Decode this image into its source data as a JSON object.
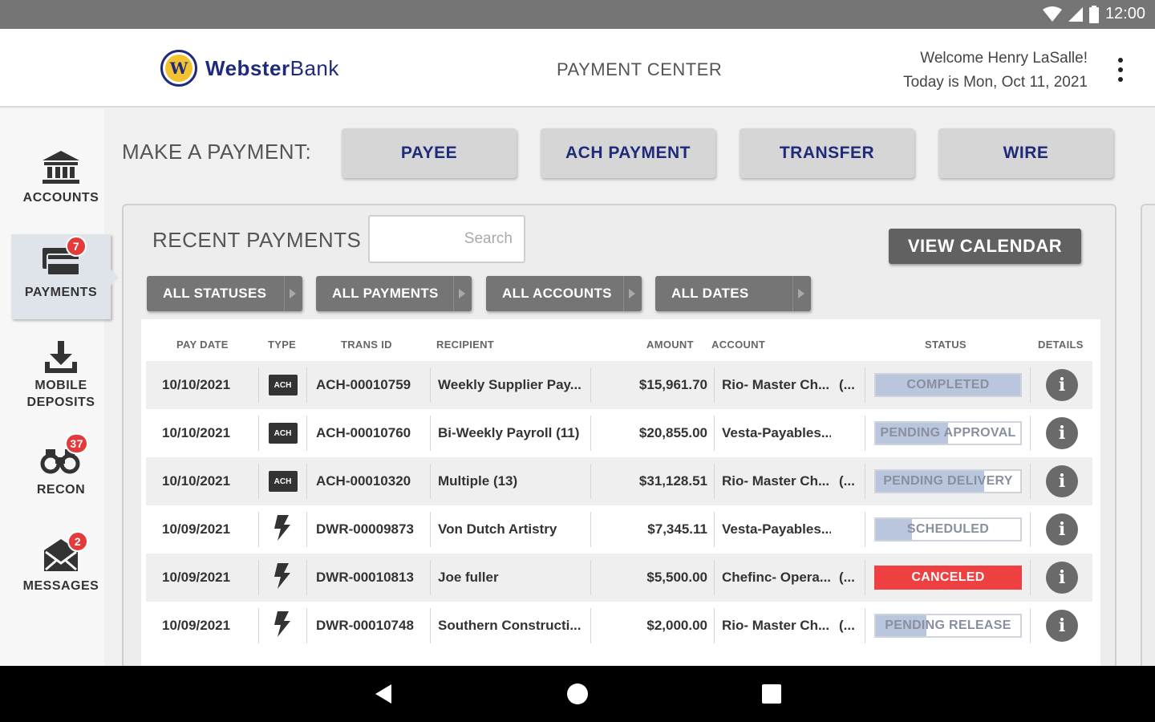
{
  "status_bar": {
    "time": "12:00"
  },
  "header": {
    "brand_part1": "Webster",
    "brand_part2": "Bank",
    "title": "PAYMENT CENTER",
    "welcome": "Welcome Henry LaSalle!",
    "date": "Today is Mon, Oct 11, 2021"
  },
  "sidebar": {
    "items": [
      {
        "label": "ACCOUNTS",
        "icon": "bank-icon",
        "badge": ""
      },
      {
        "label": "PAYMENTS",
        "icon": "payments-icon",
        "badge": "7"
      },
      {
        "label_line1": "MOBILE",
        "label_line2": "DEPOSITS",
        "icon": "download-tray-icon",
        "badge": ""
      },
      {
        "label": "RECON",
        "icon": "binoculars-icon",
        "badge": "37"
      },
      {
        "label": "MESSAGES",
        "icon": "envelope-icon",
        "badge": "2"
      }
    ]
  },
  "make_payment": {
    "label": "MAKE A PAYMENT:",
    "buttons": [
      "PAYEE",
      "ACH PAYMENT",
      "TRANSFER",
      "WIRE"
    ]
  },
  "recent_payments": {
    "title": "RECENT PAYMENTS",
    "search_placeholder": "Search",
    "view_calendar": "VIEW CALENDAR",
    "filters": [
      "ALL STATUSES",
      "ALL PAYMENTS",
      "ALL ACCOUNTS",
      "ALL DATES"
    ],
    "columns": [
      "PAY DATE",
      "TYPE",
      "TRANS ID",
      "RECIPIENT",
      "AMOUNT",
      "ACCOUNT",
      "STATUS",
      "DETAILS"
    ],
    "rows": [
      {
        "date": "10/10/2021",
        "type": "ACH",
        "trans_id": "ACH-00010759",
        "recipient": "Weekly Supplier Pay...",
        "amount": "$15,961.70",
        "account": "Rio- Master Ch...",
        "account_suffix": "(...",
        "status": "COMPLETED",
        "status_progress": 1.0
      },
      {
        "date": "10/10/2021",
        "type": "ACH",
        "trans_id": "ACH-00010760",
        "recipient": "Bi-Weekly Payroll (11)",
        "amount": "$20,855.00",
        "account": "Vesta-Payables.....",
        "account_suffix": "",
        "status": "PENDING APPROVAL",
        "status_progress": 0.5
      },
      {
        "date": "10/10/2021",
        "type": "ACH",
        "trans_id": "ACH-00010320",
        "recipient": "Multiple (13)",
        "amount": "$31,128.51",
        "account": "Rio- Master Ch...",
        "account_suffix": "(...",
        "status": "PENDING DELIVERY",
        "status_progress": 0.75
      },
      {
        "date": "10/09/2021",
        "type": "WIRE",
        "trans_id": "DWR-00009873",
        "recipient": "Von Dutch Artistry",
        "amount": "$7,345.11",
        "account": "Vesta-Payables.....",
        "account_suffix": "",
        "status": "SCHEDULED",
        "status_progress": 0.25
      },
      {
        "date": "10/09/2021",
        "type": "WIRE",
        "trans_id": "DWR-00010813",
        "recipient": "Joe fuller",
        "amount": "$5,500.00",
        "account": "Chefinc- Opera...",
        "account_suffix": "(...",
        "status": "CANCELED",
        "status_progress": 1.0
      },
      {
        "date": "10/09/2021",
        "type": "WIRE",
        "trans_id": "DWR-00010748",
        "recipient": "Southern Constructi...",
        "amount": "$2,000.00",
        "account": "Rio- Master Ch...",
        "account_suffix": "(...",
        "status": "PENDING RELEASE",
        "status_progress": 0.35
      }
    ]
  },
  "colors": {
    "brand_navy": "#1f2b7a",
    "brand_gold": "#f2c230",
    "badge_red": "#e33b3b",
    "canceled_red": "#ee4040",
    "status_fill": "#b9c6de"
  }
}
